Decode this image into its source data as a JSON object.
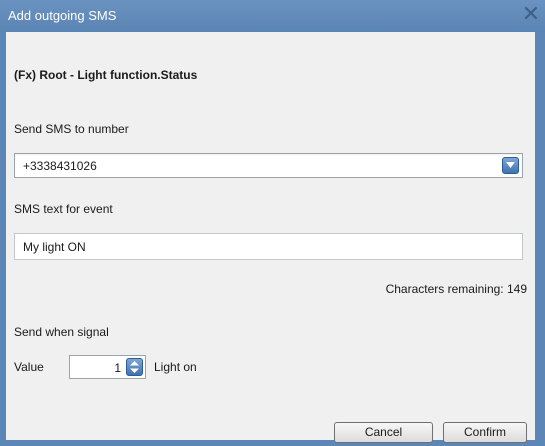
{
  "dialog": {
    "title": "Add outgoing SMS",
    "heading": "(Fx) Root - Light function.Status"
  },
  "number": {
    "label": "Send SMS to number",
    "value": "+3338431026"
  },
  "text": {
    "label": "SMS text for event",
    "value": "My light ON"
  },
  "characters_remaining": "Characters remaining: 149",
  "signal": {
    "label": "Send when signal",
    "value_label": "Value",
    "value": "1",
    "unit_label": "Light on"
  },
  "buttons": {
    "cancel": "Cancel",
    "confirm": "Confirm"
  },
  "icons": {
    "close": "close-icon",
    "dropdown": "chevron-down-icon",
    "spinner": "spinner-arrows-icon"
  },
  "colors": {
    "titlebar": "#5a84b3",
    "accent": "#3f72b0",
    "panel": "#f0f0f0"
  }
}
